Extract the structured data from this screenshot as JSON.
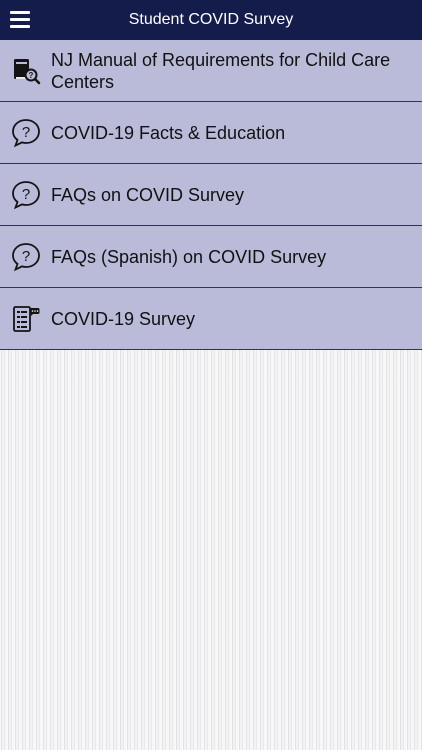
{
  "header": {
    "title": "Student COVID Survey",
    "menu_icon": "hamburger-menu-icon"
  },
  "menu": {
    "items": [
      {
        "label": "NJ Manual of Requirements for Child Care Centers",
        "icon": "book-search-icon"
      },
      {
        "label": "COVID-19 Facts & Education",
        "icon": "question-bubble-icon"
      },
      {
        "label": "FAQs on COVID Survey",
        "icon": "question-bubble-icon"
      },
      {
        "label": "FAQs (Spanish) on COVID Survey",
        "icon": "question-bubble-icon"
      },
      {
        "label": "COVID-19 Survey",
        "icon": "survey-form-icon"
      }
    ]
  },
  "colors": {
    "header_bg": "#141c4c",
    "item_bg": "#b9bbd9",
    "divider": "#33353f"
  }
}
